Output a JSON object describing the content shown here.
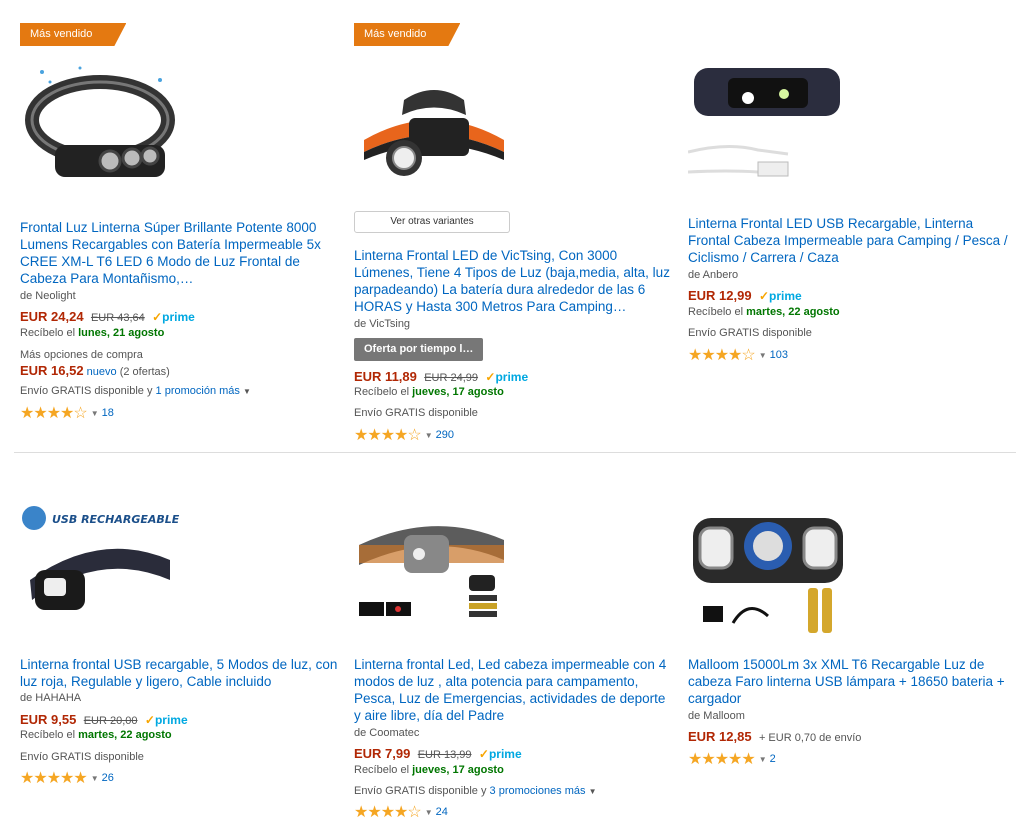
{
  "products": [
    {
      "badge": "Más vendido",
      "title": "Frontal Luz Linterna Súper Brillante Potente 8000 Lumens Recargables con Batería Impermeable 5x CREE XM-L T6 LED 6 Modo de Luz Frontal de Cabeza Para Montañismo,…",
      "brand": "de Neolight",
      "price": "EUR 24,24",
      "old_price": "EUR 43,64",
      "prime": "prime",
      "delivery_prefix": "Recíbelo el",
      "delivery_date": "lunes, 21 agosto",
      "more_options": "Más opciones de compra",
      "alt_price": "EUR 16,52",
      "alt_new": "nuevo",
      "alt_offers": "(2 ofertas)",
      "shipping": "Envío GRATIS disponible y",
      "promo": "1 promoción más",
      "rating": "★★★★☆",
      "reviews": "18"
    },
    {
      "badge": "Más vendido",
      "variants_button": "Ver otras variantes",
      "title": "Linterna Frontal LED de VicTsing, Con 3000 Lúmenes, Tiene 4 Tipos de Luz (baja,media, alta, luz parpadeando) La batería dura alrededor de las 6 HORAS y Hasta 300 Metros Para Camping…",
      "brand": "de VicTsing",
      "deal_button": "Oferta por tiempo l…",
      "price": "EUR 11,89",
      "old_price": "EUR 24,99",
      "prime": "prime",
      "delivery_prefix": "Recíbelo el",
      "delivery_date": "jueves, 17 agosto",
      "shipping": "Envío GRATIS disponible",
      "rating": "★★★★☆",
      "reviews": "290"
    },
    {
      "title": "Linterna Frontal LED USB Recargable, Linterna Frontal Cabeza Impermeable para Camping / Pesca / Ciclismo / Carrera / Caza",
      "brand": "de Anbero",
      "price": "EUR 12,99",
      "prime": "prime",
      "delivery_prefix": "Recíbelo el",
      "delivery_date": "martes, 22 agosto",
      "shipping": "Envío GRATIS disponible",
      "rating": "★★★★☆",
      "reviews": "103"
    },
    {
      "title": "Linterna frontal USB recargable, 5 Modos de luz, con luz roja, Regulable y ligero, Cable incluido",
      "brand": "de HAHAHA",
      "price": "EUR 9,55",
      "old_price": "EUR 20,00",
      "prime": "prime",
      "delivery_prefix": "Recíbelo el",
      "delivery_date": "martes, 22 agosto",
      "shipping": "Envío GRATIS disponible",
      "rating": "★★★★★",
      "reviews": "26",
      "image_text": "USB RECHARGEABLE"
    },
    {
      "title": "Linterna frontal Led, Led cabeza impermeable con 4 modos de luz , alta potencia para campamento, Pesca, Luz de Emergencias, actividades de deporte y aire libre, día del Padre",
      "brand": "de Coomatec",
      "price": "EUR 7,99",
      "old_price": "EUR 13,99",
      "prime": "prime",
      "delivery_prefix": "Recíbelo el",
      "delivery_date": "jueves, 17 agosto",
      "shipping": "Envío GRATIS disponible y",
      "promo": "3 promociones más",
      "rating": "★★★★☆",
      "reviews": "24"
    },
    {
      "title": "Malloom 15000Lm 3x XML T6 Recargable Luz de cabeza Faro linterna USB lámpara + 18650 bateria + cargador",
      "brand": "de Malloom",
      "price": "EUR 12,85",
      "shipping_cost": "+ EUR 0,70 de envío",
      "rating": "★★★★★",
      "reviews": "2"
    }
  ],
  "colors": {
    "link": "#0066c0",
    "price": "#b12704",
    "badge": "#e47911",
    "prime": "#00a8e1",
    "delivery": "#007600"
  }
}
